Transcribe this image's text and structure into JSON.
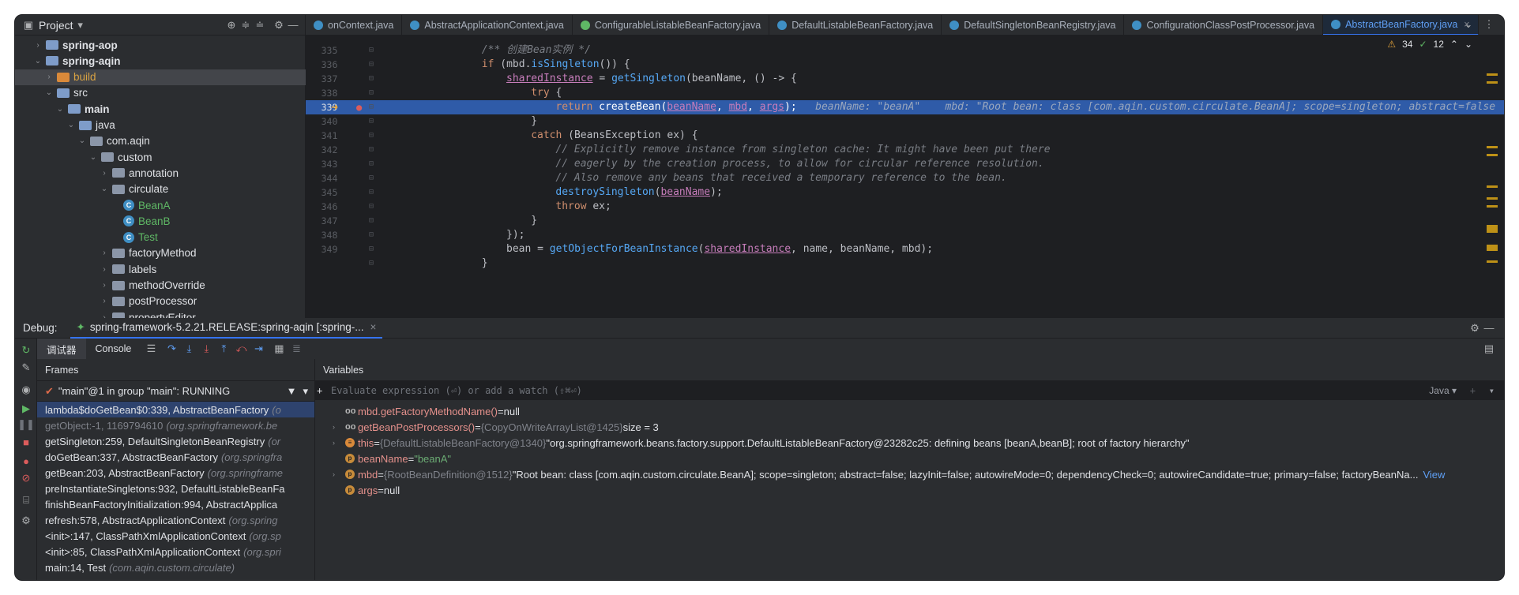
{
  "project": {
    "title": "Project",
    "tree": [
      {
        "label": "spring-aop",
        "indent": 1,
        "kind": "folder",
        "chev": "›",
        "bold": true
      },
      {
        "label": "spring-aqin",
        "indent": 1,
        "kind": "folder",
        "chev": "⌄",
        "bold": true
      },
      {
        "label": "build",
        "indent": 2,
        "kind": "orange",
        "chev": "›",
        "selected": true
      },
      {
        "label": "src",
        "indent": 2,
        "kind": "folder",
        "chev": "⌄"
      },
      {
        "label": "main",
        "indent": 3,
        "kind": "folder",
        "chev": "⌄",
        "bold": true
      },
      {
        "label": "java",
        "indent": 4,
        "kind": "folder",
        "chev": "⌄"
      },
      {
        "label": "com.aqin",
        "indent": 5,
        "kind": "pkg",
        "chev": "⌄"
      },
      {
        "label": "custom",
        "indent": 6,
        "kind": "pkg",
        "chev": "⌄"
      },
      {
        "label": "annotation",
        "indent": 7,
        "kind": "pkg",
        "chev": "›"
      },
      {
        "label": "circulate",
        "indent": 7,
        "kind": "pkg",
        "chev": "⌄"
      },
      {
        "label": "BeanA",
        "indent": 8,
        "kind": "class",
        "chev": "",
        "green": true
      },
      {
        "label": "BeanB",
        "indent": 8,
        "kind": "class",
        "chev": "",
        "green": true
      },
      {
        "label": "Test",
        "indent": 8,
        "kind": "class",
        "chev": "",
        "green": true
      },
      {
        "label": "factoryMethod",
        "indent": 7,
        "kind": "pkg",
        "chev": "›"
      },
      {
        "label": "labels",
        "indent": 7,
        "kind": "pkg",
        "chev": "›"
      },
      {
        "label": "methodOverride",
        "indent": 7,
        "kind": "pkg",
        "chev": "›"
      },
      {
        "label": "postProcessor",
        "indent": 7,
        "kind": "pkg",
        "chev": "›"
      },
      {
        "label": "propertyEditor",
        "indent": 7,
        "kind": "pkg",
        "chev": "›"
      }
    ]
  },
  "tabs": [
    {
      "label": "onContext.java",
      "icon": "class"
    },
    {
      "label": "AbstractApplicationContext.java",
      "icon": "class"
    },
    {
      "label": "ConfigurableListableBeanFactory.java",
      "icon": "interface"
    },
    {
      "label": "DefaultListableBeanFactory.java",
      "icon": "class"
    },
    {
      "label": "DefaultSingletonBeanRegistry.java",
      "icon": "class"
    },
    {
      "label": "ConfigurationClassPostProcessor.java",
      "icon": "class"
    },
    {
      "label": "AbstractBeanFactory.java",
      "icon": "class",
      "active": true
    }
  ],
  "editor": {
    "warnings": "34",
    "checks": "12",
    "lines": [
      {
        "no": "335",
        "html": "<span class='cm'>/** 创建Bean实例 */</span>",
        "indent": 16
      },
      {
        "no": "336",
        "html": "<span class='kw'>if</span> (mbd.<span class='fn'>isSingleton</span>()) {",
        "indent": 16
      },
      {
        "no": "337",
        "html": "<span class='u'>sharedInstance</span> = <span class='fn'>getSingleton</span>(beanName, () -> {",
        "indent": 20
      },
      {
        "no": "338",
        "html": "<span class='kw'>try</span> {",
        "indent": 24
      },
      {
        "no": "339",
        "html": "<span class='kw'>return</span> createBean(<span class='u'>beanName</span>, <span class='u'>mbd</span>, <span class='u'>args</span>);   <span class='hint'>beanName: \"beanA\"    mbd: \"Root bean: class [com.aqin.custom.circulate.BeanA]; scope=singleton; abstract=false</span>",
        "indent": 28,
        "highlight": true
      },
      {
        "no": "340",
        "html": "}",
        "indent": 24
      },
      {
        "no": "341",
        "html": "<span class='kw'>catch</span> (BeansException ex) {",
        "indent": 24
      },
      {
        "no": "342",
        "html": "<span class='cm'>// Explicitly remove instance from singleton cache: It might have been put there</span>",
        "indent": 28
      },
      {
        "no": "343",
        "html": "<span class='cm'>// eagerly by the creation process, to allow for circular reference resolution.</span>",
        "indent": 28
      },
      {
        "no": "344",
        "html": "<span class='cm'>// Also remove any beans that received a temporary reference to the bean.</span>",
        "indent": 28
      },
      {
        "no": "345",
        "html": "<span class='fn'>destroySingleton</span>(<span class='u'>beanName</span>);",
        "indent": 28
      },
      {
        "no": "346",
        "html": "<span class='kw'>throw</span> ex;",
        "indent": 28
      },
      {
        "no": "347",
        "html": "}",
        "indent": 24
      },
      {
        "no": "348",
        "html": "});",
        "indent": 20
      },
      {
        "no": "349",
        "html": "bean = <span class='fn'>getObjectForBeanInstance</span>(<span class='u'>sharedInstance</span>, name, beanName, mbd);",
        "indent": 20
      },
      {
        "no": "",
        "html": "}",
        "indent": 16
      }
    ]
  },
  "debug": {
    "label": "Debug:",
    "session": "spring-framework-5.2.21.RELEASE:spring-aqin [:spring-...",
    "tab_debugger": "调试器",
    "tab_console": "Console",
    "frames_title": "Frames",
    "variables_title": "Variables",
    "thread": "\"main\"@1 in group \"main\": RUNNING",
    "eval_placeholder": "Evaluate expression (⏎) or add a watch (⇧⌘⏎)",
    "eval_lang": "Java ▾",
    "frames": [
      {
        "method": "lambda$doGetBean$0:339, AbstractBeanFactory",
        "pkg": "(o",
        "selected": true
      },
      {
        "method": "getObject:-1, 1169794610",
        "pkg": "(org.springframework.be",
        "dim": true
      },
      {
        "method": "getSingleton:259, DefaultSingletonBeanRegistry",
        "pkg": "(or"
      },
      {
        "method": "doGetBean:337, AbstractBeanFactory",
        "pkg": "(org.springfra"
      },
      {
        "method": "getBean:203, AbstractBeanFactory",
        "pkg": "(org.springframe"
      },
      {
        "method": "preInstantiateSingletons:932, DefaultListableBeanFa",
        "pkg": ""
      },
      {
        "method": "finishBeanFactoryInitialization:994, AbstractApplica",
        "pkg": ""
      },
      {
        "method": "refresh:578, AbstractApplicationContext",
        "pkg": "(org.spring"
      },
      {
        "method": "<init>:147, ClassPathXmlApplicationContext",
        "pkg": "(org.sp"
      },
      {
        "method": "<init>:85, ClassPathXmlApplicationContext",
        "pkg": "(org.spri"
      },
      {
        "method": "main:14, Test",
        "pkg": "(com.aqin.custom.circulate)"
      }
    ],
    "variables": [
      {
        "chev": "",
        "icon": "oo",
        "name": "mbd.getFactoryMethodName()",
        "eq": " = ",
        "type": "",
        "value": "null"
      },
      {
        "chev": "›",
        "icon": "oo",
        "name": "getBeanPostProcessors()",
        "eq": " = ",
        "type": "{CopyOnWriteArrayList@1425} ",
        "value": " size = 3"
      },
      {
        "chev": "›",
        "icon": "≡",
        "name": "this",
        "eq": " = ",
        "type": "{DefaultListableBeanFactory@1340} ",
        "value": "\"org.springframework.beans.factory.support.DefaultListableBeanFactory@23282c25: defining beans [beanA,beanB]; root of factory hierarchy\""
      },
      {
        "chev": "",
        "icon": "p",
        "name": "beanName",
        "eq": " = ",
        "type": "",
        "value": "\"beanA\"",
        "str": true
      },
      {
        "chev": "›",
        "icon": "p",
        "name": "mbd",
        "eq": " = ",
        "type": "{RootBeanDefinition@1512} ",
        "value": "\"Root bean: class [com.aqin.custom.circulate.BeanA]; scope=singleton; abstract=false; lazyInit=false; autowireMode=0; dependencyCheck=0; autowireCandidate=true; primary=false; factoryBeanNa...",
        "link": "View"
      },
      {
        "chev": "",
        "icon": "p",
        "name": "args",
        "eq": " = ",
        "type": "",
        "value": "null"
      }
    ]
  }
}
